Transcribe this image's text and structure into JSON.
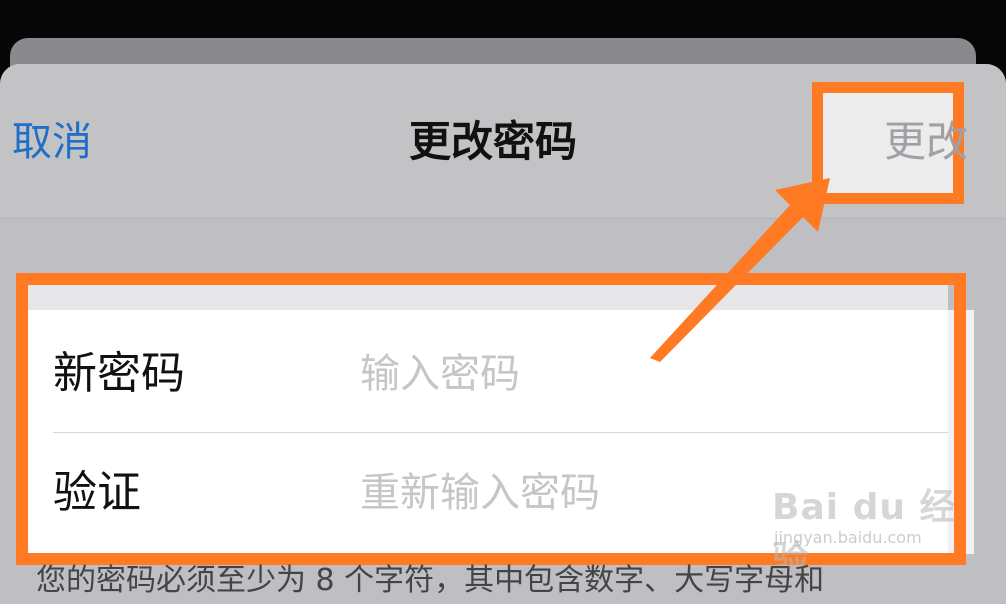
{
  "header": {
    "cancel_label": "取消",
    "title": "更改密码",
    "change_label": "更改"
  },
  "form": {
    "rows": [
      {
        "label": "新密码",
        "placeholder": "输入密码"
      },
      {
        "label": "验证",
        "placeholder": "重新输入密码"
      }
    ]
  },
  "footer": {
    "hint": "您的密码必须至少为 8 个字符，其中包含数字、大写字母和"
  },
  "watermark": {
    "brand": "Bai du 经验",
    "url": "jingyan.baidu.com"
  },
  "colors": {
    "accent_blue": "#1f6fc6",
    "highlight_orange": "#ff7a22",
    "disabled_text": "#a0a0a6",
    "placeholder": "#c6c6c9"
  },
  "icons": {
    "annotation_arrow": "arrow-icon"
  }
}
